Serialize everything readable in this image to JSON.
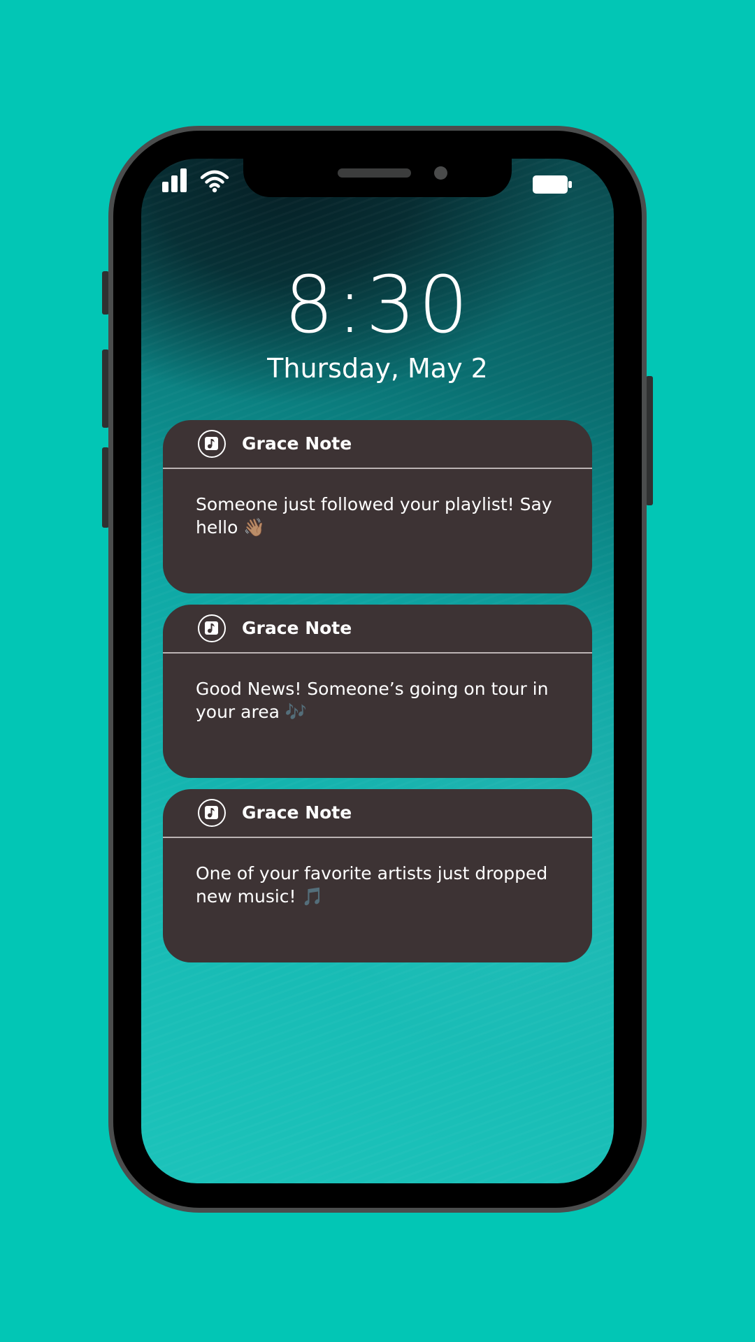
{
  "colors": {
    "background": "#02c6b5",
    "notification_card": "#3d3334",
    "text": "#ffffff"
  },
  "status_bar": {
    "icons": [
      "cellular-signal-icon",
      "wifi-icon",
      "battery-icon"
    ]
  },
  "lock_screen": {
    "time": "8:30",
    "date": "Thursday, May 2"
  },
  "notifications": [
    {
      "app_icon": "music-note-icon",
      "app_name": "Grace Note",
      "message": "Someone just followed your playlist! Say hello 👋🏽"
    },
    {
      "app_icon": "music-note-icon",
      "app_name": "Grace Note",
      "message": "Good News! Someone’s going on tour in your area 🎶"
    },
    {
      "app_icon": "music-note-icon",
      "app_name": "Grace Note",
      "message": "One of your favorite artists just dropped new music! 🎵"
    }
  ]
}
